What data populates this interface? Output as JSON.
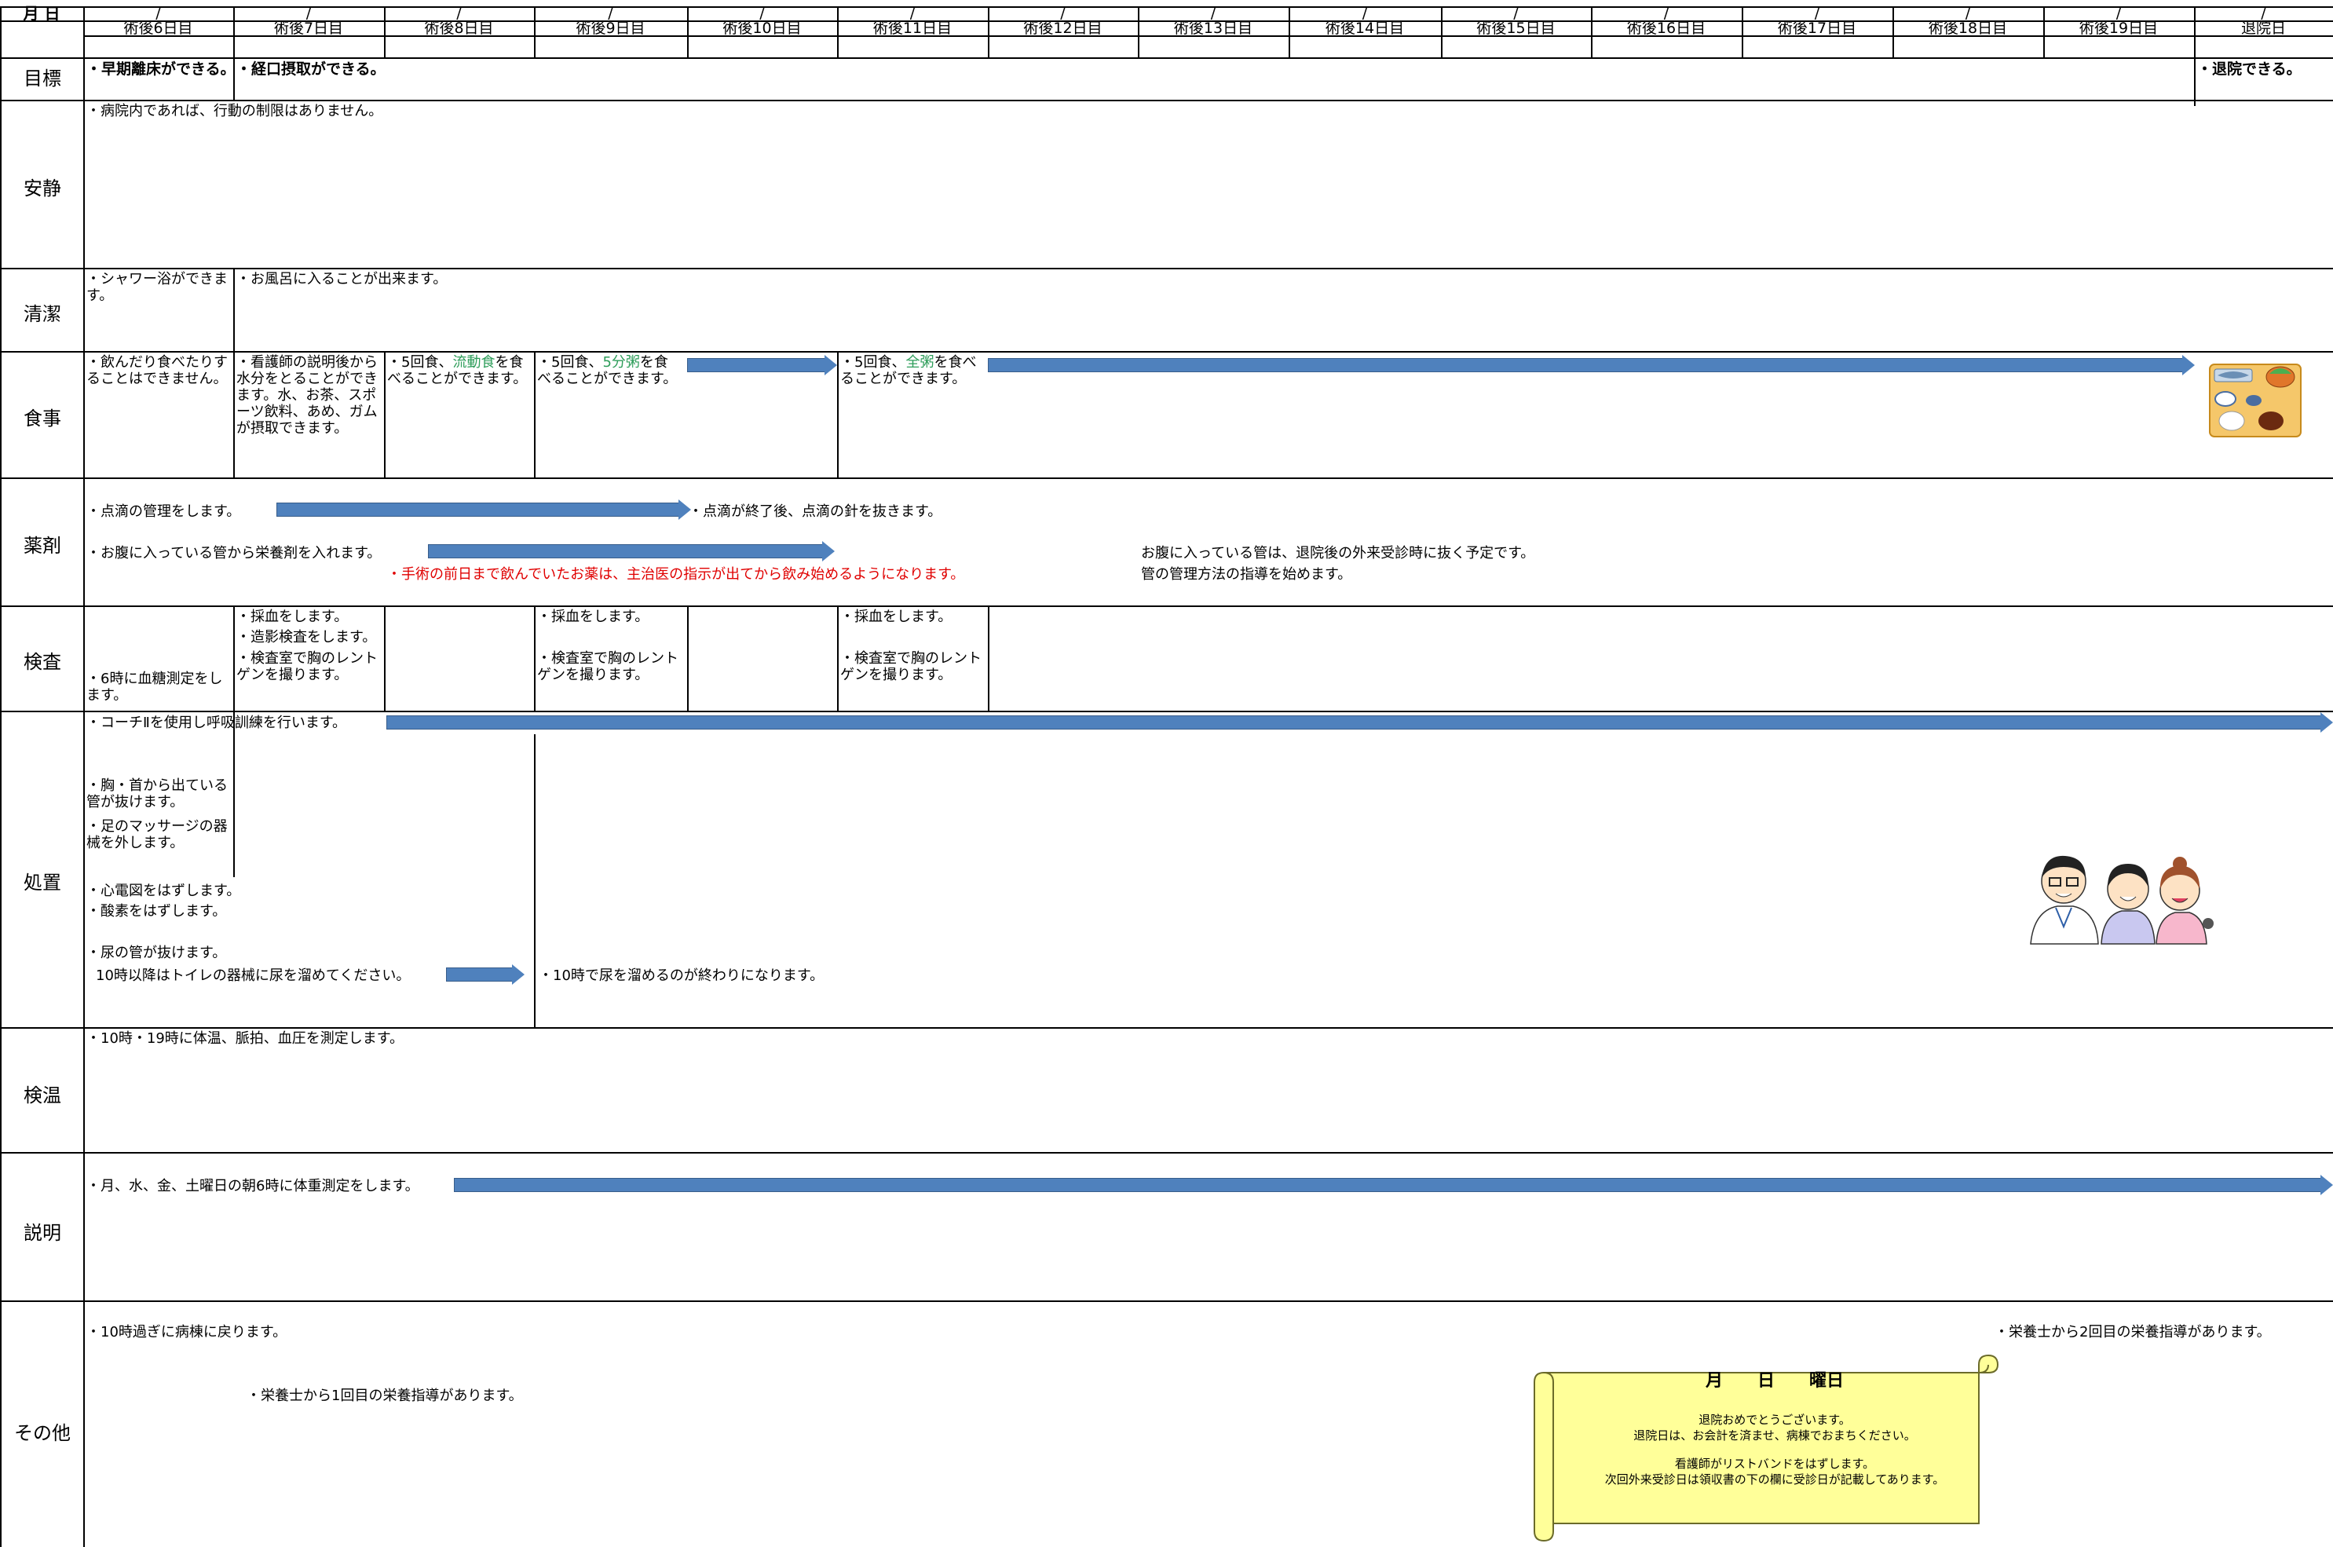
{
  "header": {
    "label": "月 日",
    "date_slash": "/",
    "days": [
      "術後6日目",
      "術後7日目",
      "術後8日目",
      "術後9日目",
      "術後10日目",
      "術後11日目",
      "術後12日目",
      "術後13日目",
      "術後14日目",
      "術後15日目",
      "術後16日目",
      "術後17日目",
      "術後18日目",
      "術後19日目",
      "退院日"
    ]
  },
  "rows": {
    "goal": "目標",
    "rest": "安静",
    "clean": "清潔",
    "meal": "食事",
    "medicine": "薬剤",
    "exam": "検査",
    "treatment": "処置",
    "vitals": "検温",
    "explanation": "説明",
    "other": "その他"
  },
  "goal": {
    "d6": "・早期離床ができる。",
    "d7": "・経口摂取ができる。",
    "discharge": "・退院できる。"
  },
  "rest": {
    "text": "・病院内であれば、行動の制限はありません。"
  },
  "clean": {
    "d6": "・シャワー浴ができます。",
    "d7": "・お風呂に入ることが出来ます。"
  },
  "meal": {
    "d6": "・飲んだり食べたりすることはできません。",
    "d7": "・看護師の説明後から水分をとることができます。水、お茶、スポーツ飲料、あめ、ガムが摂取できます。",
    "d8_pre": "・5回食、",
    "d8_green": "流動食",
    "d8_post": "を食べることができます。",
    "d9_pre": "・5回食、",
    "d9_green": "5分粥",
    "d9_post": "を食べることができます。",
    "d11_pre": "・5回食、",
    "d11_green": "全粥",
    "d11_post": "を食べることができます。"
  },
  "medicine": {
    "drip": "・点滴の管理をします。",
    "drip_end": "・点滴が終了後、点滴の針を抜きます。",
    "tube": "・お腹に入っている管から栄養剤を入れます。",
    "warning": "・手術の前日まで飲んでいたお薬は、主治医の指示が出てから飲み始めるようになります。",
    "tube_note1": "お腹に入っている管は、退院後の外来受診時に抜く予定です。",
    "tube_note2": "管の管理方法の指導を始めます。"
  },
  "exam": {
    "d6": "・6時に血糖測定をします。",
    "d7_1": "・採血をします。",
    "d7_2": "・造影検査をします。",
    "d7_3": "・検査室で胸のレントゲンを撮ります。",
    "d9_1": "・採血をします。",
    "d9_2": "・検査室で胸のレントゲンを撮ります。",
    "d11_1": "・採血をします。",
    "d11_2": "・検査室で胸のレントゲンを撮ります。"
  },
  "treatment": {
    "coach": "・コーチⅡを使用し呼吸訓練を行います。",
    "chest": "・胸・首から出ている管が抜けます。",
    "foot": "・足のマッサージの器械を外します。",
    "ecg": "・心電図をはずします。",
    "oxygen": "・酸素をはずします。",
    "urine": "・尿の管が抜けます。",
    "urine2": "10時以降はトイレの器械に尿を溜めてください。",
    "urine_end": "・10時で尿を溜めるのが終わりになります。"
  },
  "vitals": {
    "text": "・10時・19時に体温、脈拍、血圧を測定します。"
  },
  "explanation": {
    "text": "・月、水、金、土曜日の朝6時に体重測定をします。"
  },
  "other": {
    "ward": "・10時過ぎに病棟に戻ります。",
    "nutrition1": "・栄養士から1回目の栄養指導があります。",
    "nutrition2": "・栄養士から2回目の栄養指導があります。",
    "scroll_date": "月　　日　　曜日",
    "scroll_1": "退院おめでとうございます。",
    "scroll_2": "退院日は、お会計を済ませ、病棟でおまちください。",
    "scroll_3": "看護師がリストバンドをはずします。",
    "scroll_4": "次回外来受診日は領収書の下の欄に受診日が記載してあります。"
  },
  "colors": {
    "arrow": "#4f81bd",
    "scroll": "#ffff99",
    "warning": "#e00000",
    "food_highlight": "#2e9d5a"
  },
  "icons": {
    "meal_tray": "meal-tray-icon",
    "staff": "medical-staff-icon"
  }
}
